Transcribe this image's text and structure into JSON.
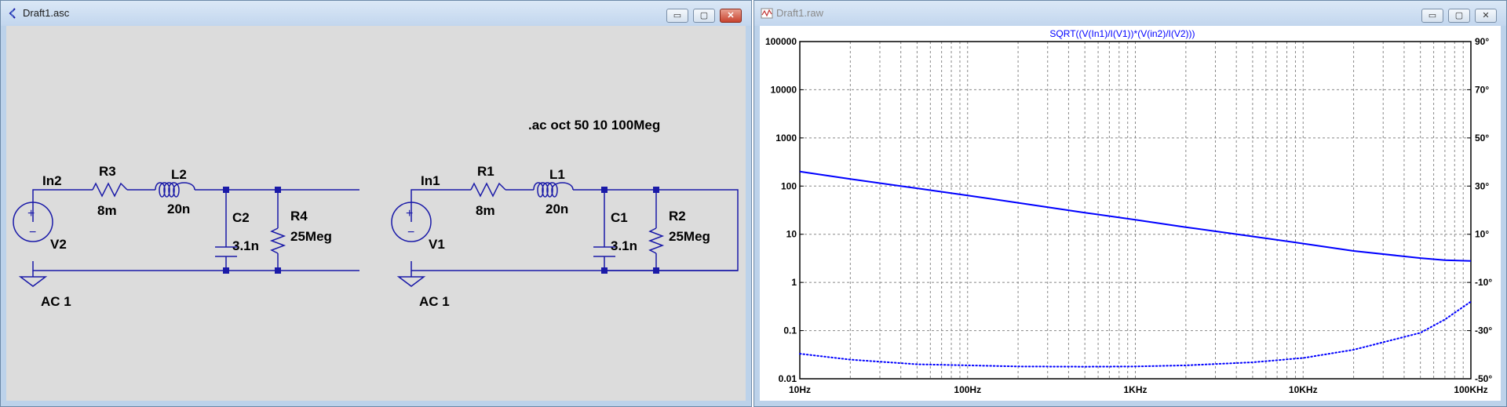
{
  "left_window": {
    "title": "Draft1.asc",
    "buttons": {
      "minimize": "▭",
      "maximize": "▢",
      "close": "✕"
    },
    "directive": ".ac oct 50 10 100Meg",
    "circuits": [
      {
        "node": "In2",
        "source": "V2",
        "source_value": "AC 1",
        "resistor": "R3",
        "resistor_value": "8m",
        "inductor": "L2",
        "inductor_value": "20n",
        "capacitor": "C2",
        "capacitor_value": "3.1n",
        "load": "R4",
        "load_value": "25Meg"
      },
      {
        "node": "In1",
        "source": "V1",
        "source_value": "AC 1",
        "resistor": "R1",
        "resistor_value": "8m",
        "inductor": "L1",
        "inductor_value": "20n",
        "capacitor": "C1",
        "capacitor_value": "3.1n",
        "load": "R2",
        "load_value": "25Meg"
      }
    ]
  },
  "right_window": {
    "title": "Draft1.raw",
    "buttons": {
      "minimize": "▭",
      "maximize": "▢",
      "close": "✕"
    }
  },
  "colors": {
    "schematic_wire": "#1a1aa8",
    "trace": "#0000ff",
    "plot_title": "#0000ff"
  },
  "chart_data": {
    "type": "line",
    "title": "SQRT((V(In1)/I(V1))*(V(in2)/I(V2)))",
    "x_scale": "log",
    "xlim": [
      10,
      100000
    ],
    "x_ticks": [
      "10Hz",
      "100Hz",
      "1KHz",
      "10KHz",
      "100KHz"
    ],
    "y_scale": "log",
    "ylim": [
      0.01,
      100000
    ],
    "y_ticks": [
      "100000",
      "10000",
      "1000",
      "100",
      "10",
      "1",
      "0.1",
      "0.01"
    ],
    "y2lim": [
      -50,
      90
    ],
    "y2_ticks": [
      "90°",
      "70°",
      "50°",
      "30°",
      "10°",
      "-10°",
      "-30°",
      "-50°"
    ],
    "grid": true,
    "series": [
      {
        "style": "solid",
        "x": [
          10,
          20,
          50,
          100,
          200,
          500,
          1000,
          2000,
          5000,
          10000,
          20000,
          50000,
          70000,
          100000
        ],
        "y": [
          200,
          140,
          90,
          64,
          45,
          28,
          20,
          14,
          9.0,
          6.4,
          4.5,
          3.2,
          2.9,
          2.8
        ]
      },
      {
        "style": "dotted",
        "x": [
          10,
          20,
          50,
          100,
          200,
          500,
          1000,
          2000,
          5000,
          10000,
          20000,
          50000,
          70000,
          100000
        ],
        "y": [
          0.033,
          0.025,
          0.02,
          0.019,
          0.018,
          0.0178,
          0.018,
          0.019,
          0.022,
          0.027,
          0.04,
          0.09,
          0.17,
          0.4
        ]
      }
    ]
  }
}
